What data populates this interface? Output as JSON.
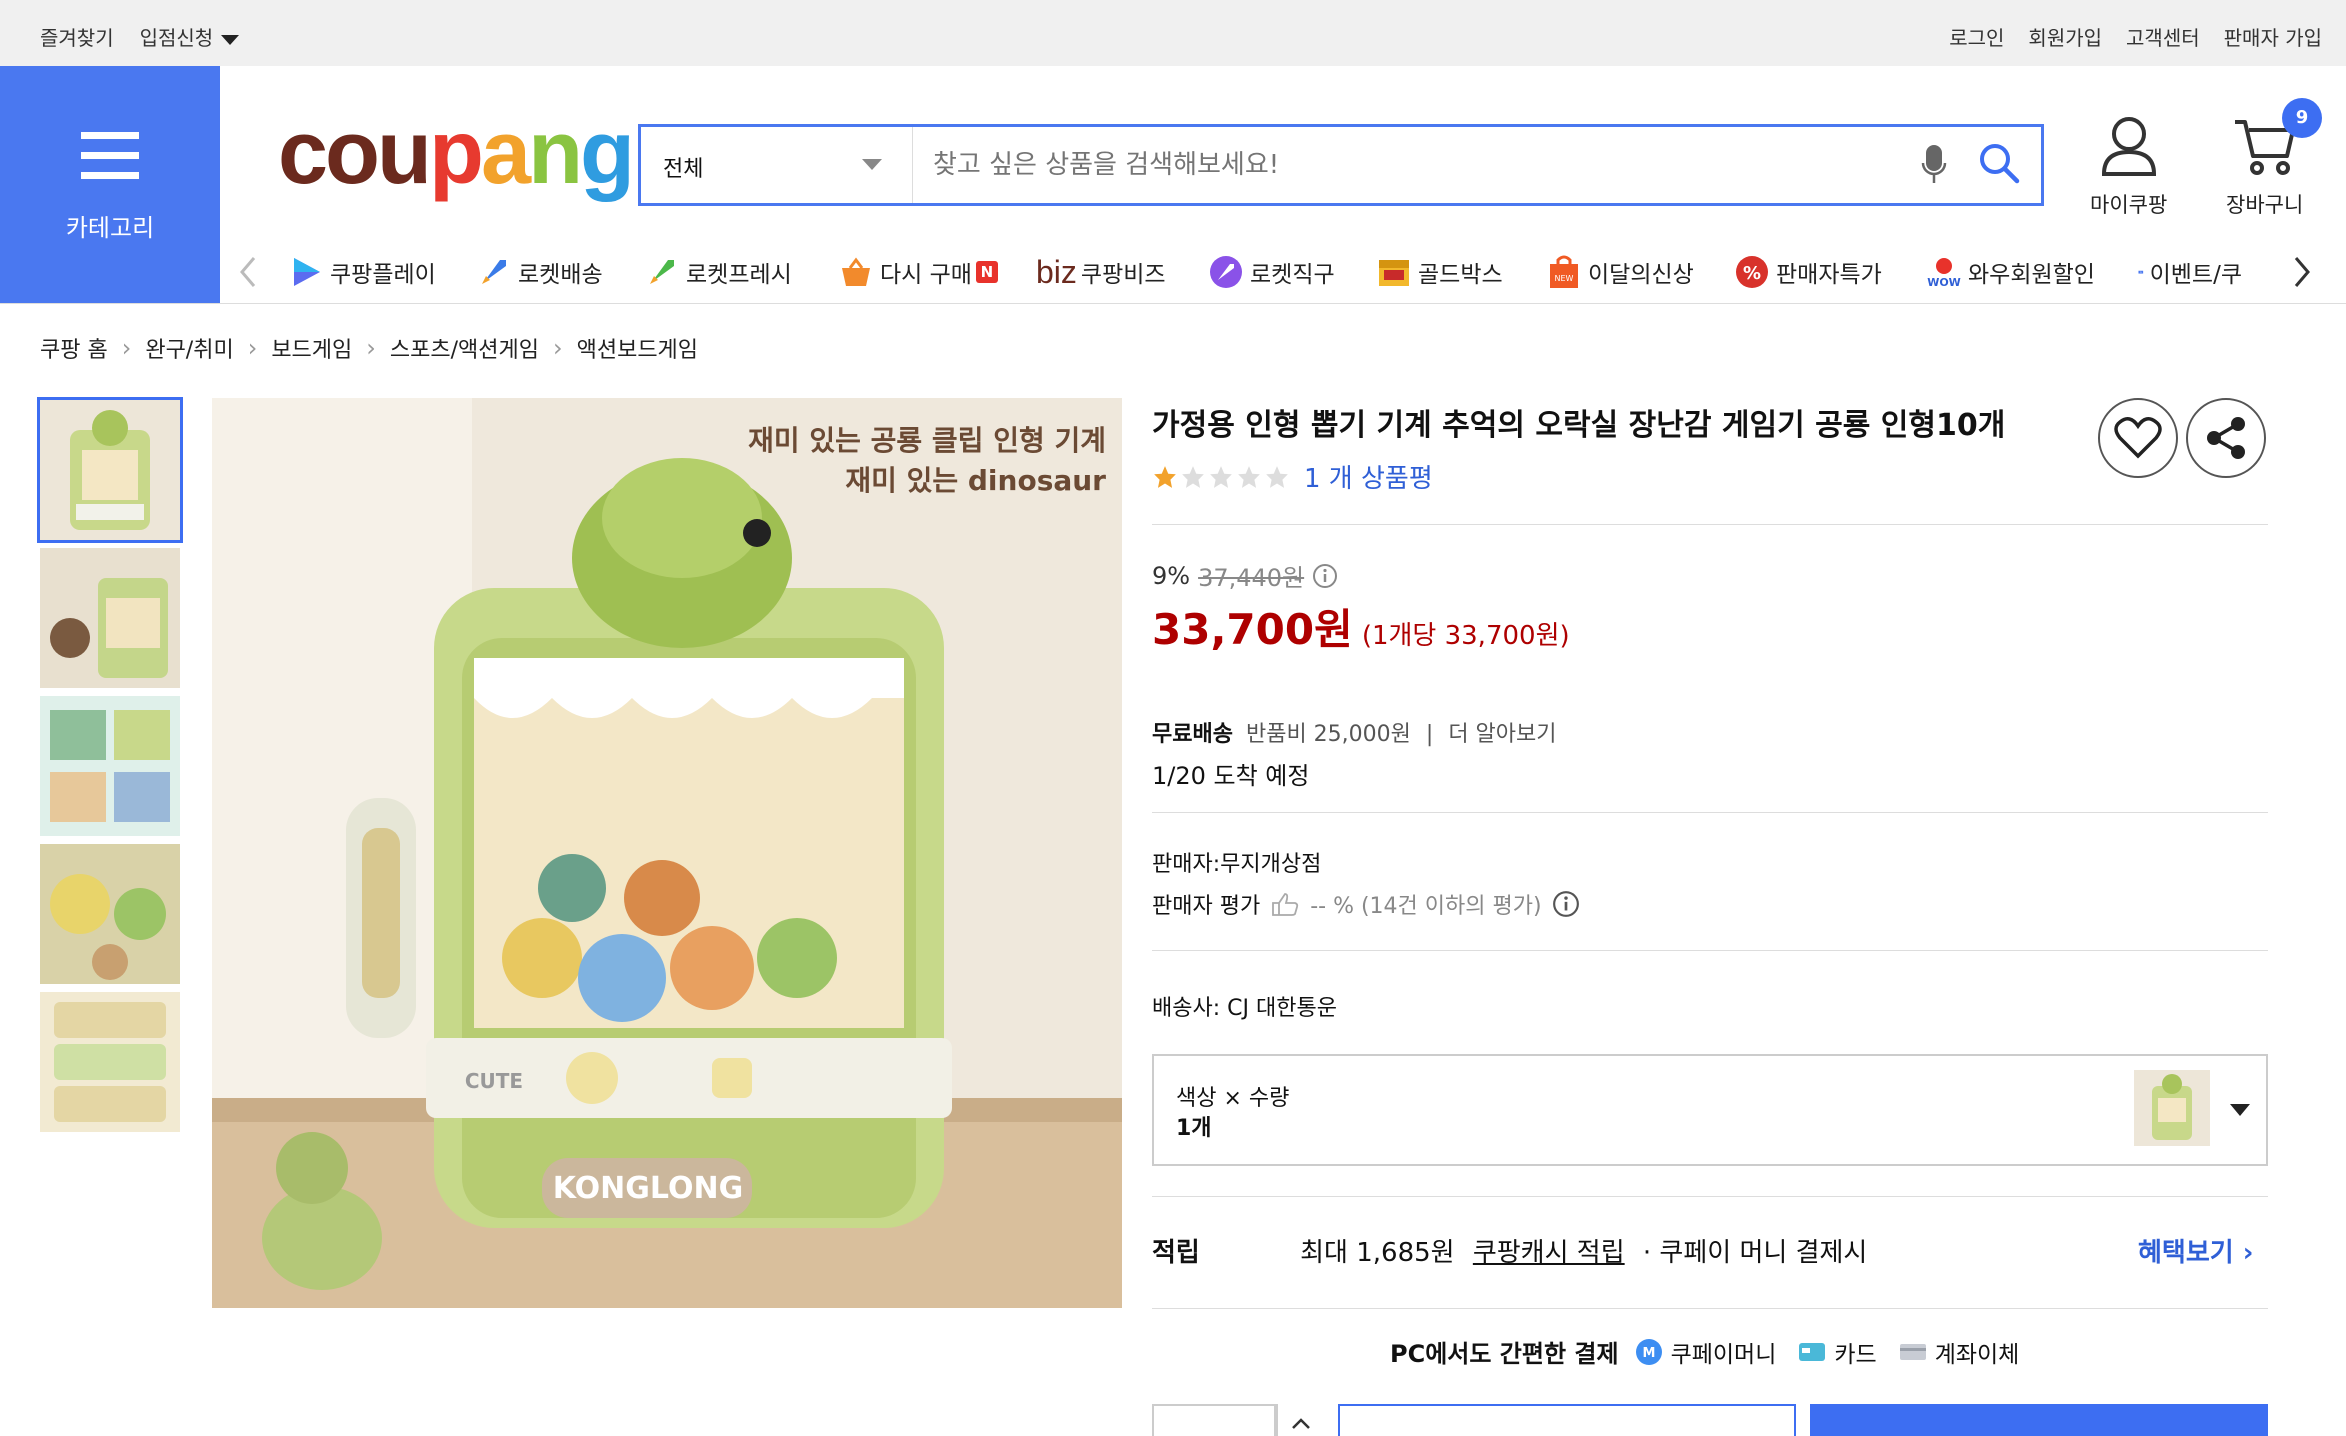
{
  "topbar": {
    "left": [
      "즐겨찾기",
      "입점신청"
    ],
    "right": [
      "로그인",
      "회원가입",
      "고객센터",
      "판매자 가입"
    ]
  },
  "category_button": {
    "label": "카테고리"
  },
  "logo": {
    "text": "coupang"
  },
  "search": {
    "category": "전체",
    "placeholder": "찾고 싶은 상품을 검색해보세요!"
  },
  "header_icons": {
    "mypage": "마이쿠팡",
    "cart": "장바구니",
    "cart_count": "9"
  },
  "shortcuts": [
    {
      "label": "쿠팡플레이",
      "icon": "play-icon"
    },
    {
      "label": "로켓배송",
      "icon": "rocket-icon"
    },
    {
      "label": "로켓프레시",
      "icon": "rocket-fresh-icon"
    },
    {
      "label": "다시 구매",
      "icon": "basket-icon",
      "badge": "N"
    },
    {
      "label": "쿠팡비즈",
      "icon": "biz-icon",
      "prefix": "biz"
    },
    {
      "label": "로켓직구",
      "icon": "rocket-direct-icon"
    },
    {
      "label": "골드박스",
      "icon": "goldbox-icon"
    },
    {
      "label": "이달의신상",
      "icon": "new-bag-icon"
    },
    {
      "label": "판매자특가",
      "icon": "percent-icon"
    },
    {
      "label": "와우회원할인",
      "icon": "wow-icon"
    },
    {
      "label": "이벤트/쿠",
      "icon": "coupon-icon"
    }
  ],
  "breadcrumb": [
    "쿠팡 홈",
    "완구/취미",
    "보드게임",
    "스포츠/액션게임",
    "액션보드게임"
  ],
  "product": {
    "image_caption_1": "재미 있는 공룡 클립 인형 기계",
    "image_caption_2": "재미 있는 dinosaur",
    "image_brand_1": "KONGLONG",
    "image_brand_2": "CUTE",
    "title": "가정용 인형 뽑기 기계 추억의 오락실 장난감 게임기 공룡 인형10개",
    "rating_stars": 1,
    "review_text": "1 개 상품평",
    "discount": "9%",
    "original_price": "37,440원",
    "price": "33,700원",
    "unit_price": "(1개당 33,700원)",
    "shipping": "무료배송",
    "return_fee": "반품비 25,000원",
    "learn_more": "더 알아보기",
    "arrival": "1/20 도착 예정",
    "seller": "판매자:무지개상점",
    "seller_rating_label": "판매자 평가",
    "seller_rating_value": "-- % (14건 이하의 평가)",
    "courier": "배송사:  CJ 대한통운",
    "option_label": "색상 × 수량",
    "option_value": "1개",
    "reward_label": "적립",
    "reward_text_1": "최대 1,685원",
    "reward_link": "쿠팡캐시 적립",
    "reward_text_2": "· 쿠페이 머니 결제시",
    "benefit_link": "혜택보기",
    "pay_title": "PC에서도 간편한 결제",
    "pay_options": [
      "쿠페이머니",
      "카드",
      "계좌이체"
    ]
  },
  "colors": {
    "accent": "#3d6ef2",
    "price": "#ae0000",
    "link": "#2f5fd6",
    "category_bg": "#4a78f0"
  }
}
